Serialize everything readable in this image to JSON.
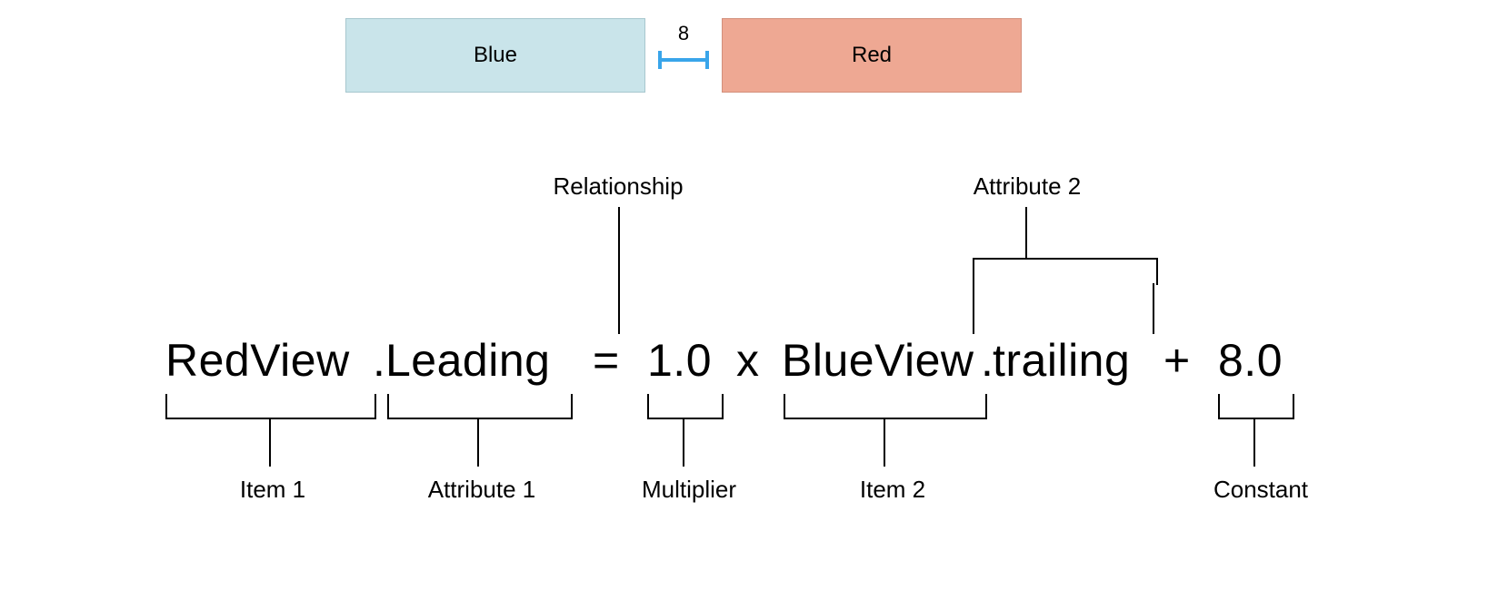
{
  "boxes": {
    "blue_label": "Blue",
    "red_label": "Red",
    "gap_value": "8"
  },
  "annotations_top": {
    "relationship": "Relationship",
    "attribute2": "Attribute 2"
  },
  "equation": {
    "item1": "RedView",
    "dot1": ".",
    "attribute1": "Leading",
    "equals": "=",
    "multiplier": "1.0",
    "times": "x",
    "item2": "BlueView",
    "dot2": ".",
    "attribute2_val": "trailing",
    "plus": "+",
    "constant_val": "8.0"
  },
  "annotations_bottom": {
    "item1": "Item 1",
    "attribute1": "Attribute 1",
    "multiplier": "Multiplier",
    "item2": "Item 2",
    "constant": "Constant"
  },
  "colors": {
    "blue_box": "#c9e4ea",
    "red_box": "#eea893",
    "gap_marker": "#39a5ea"
  }
}
